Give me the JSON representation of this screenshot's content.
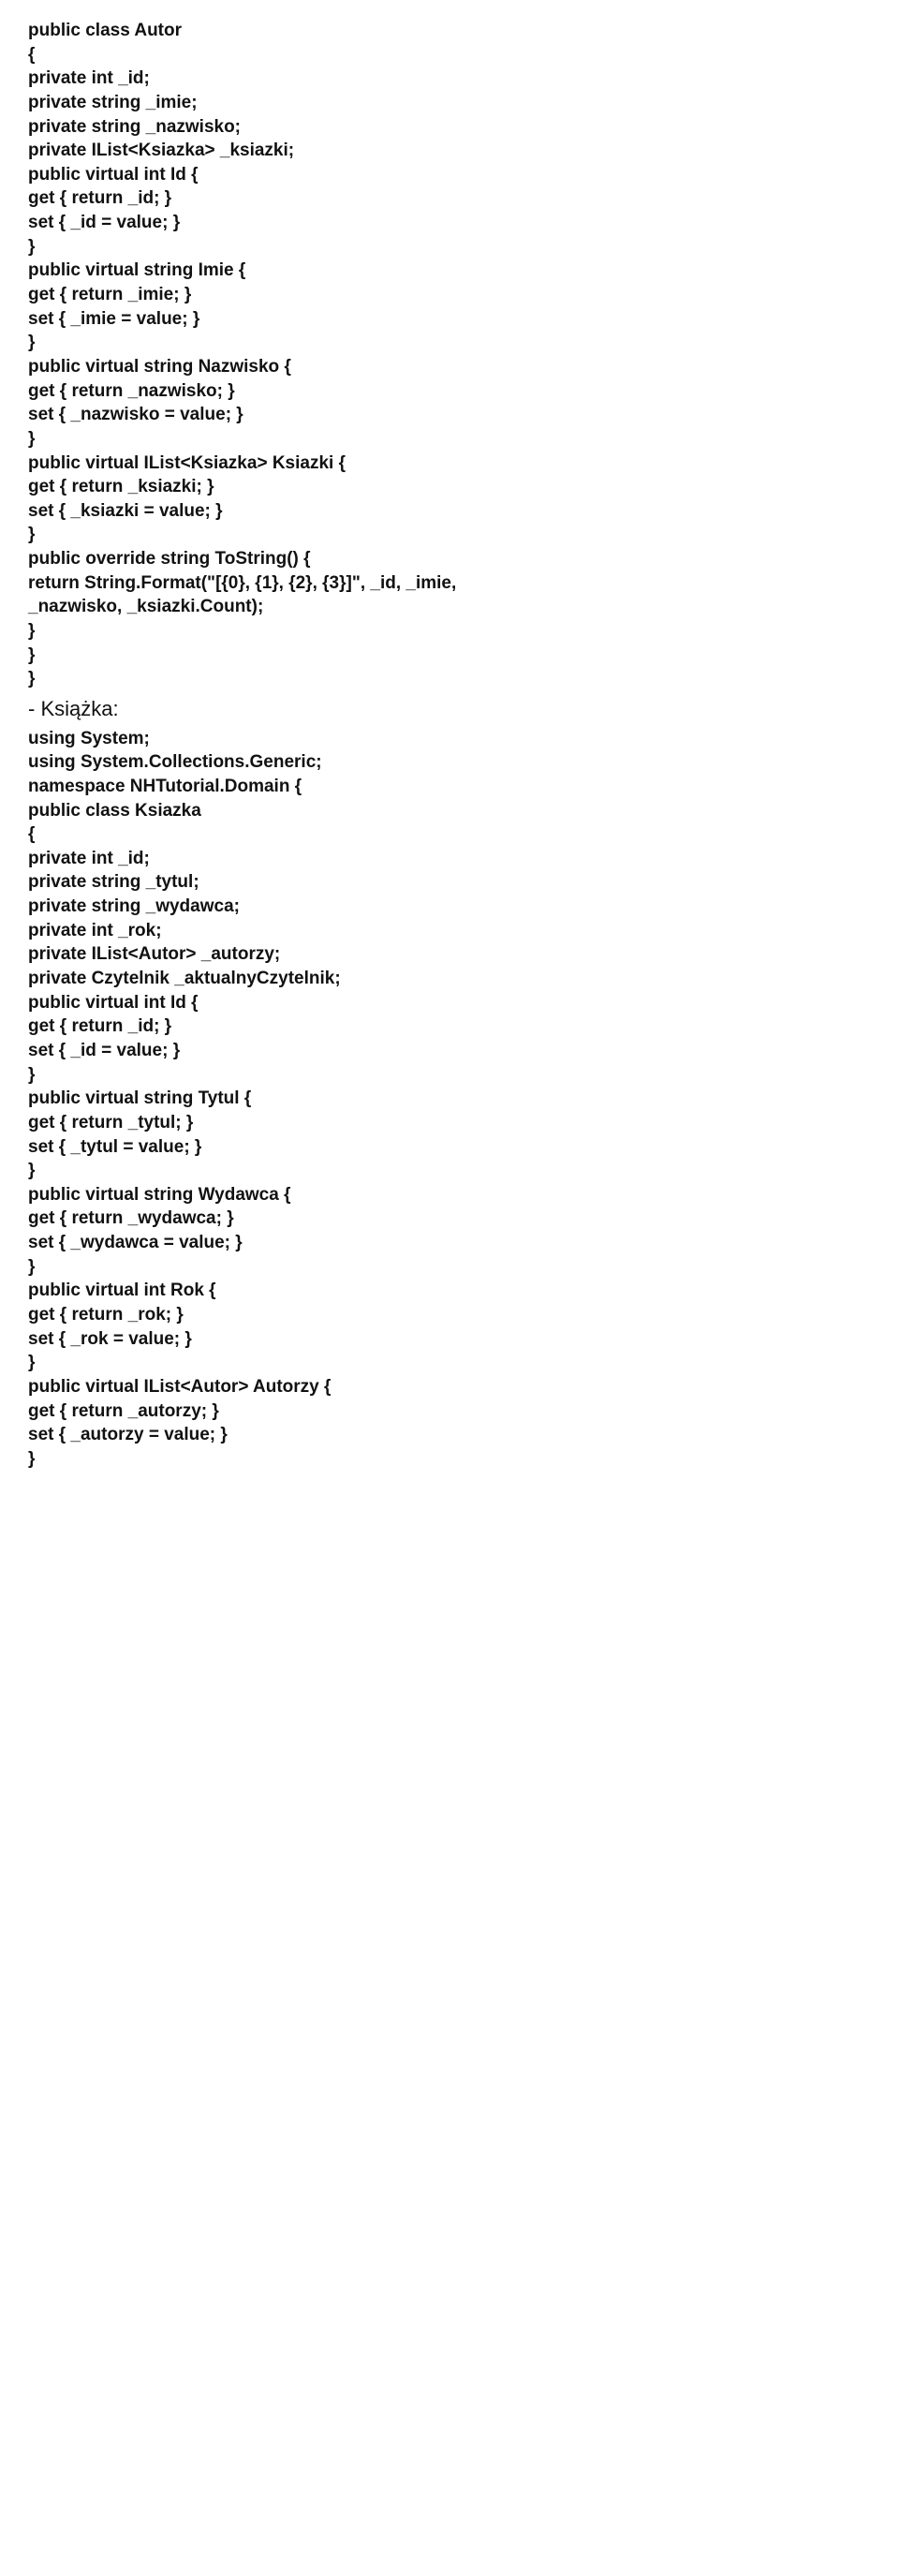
{
  "lines": [
    {
      "type": "code",
      "text": "public class Autor"
    },
    {
      "type": "code",
      "text": "{"
    },
    {
      "type": "code",
      "text": "private int _id;"
    },
    {
      "type": "code",
      "text": "private string _imie;"
    },
    {
      "type": "code",
      "text": "private string _nazwisko;"
    },
    {
      "type": "code",
      "text": "private IList<Ksiazka> _ksiazki;"
    },
    {
      "type": "code",
      "text": "public virtual int Id {"
    },
    {
      "type": "code",
      "text": "get { return _id; }"
    },
    {
      "type": "code",
      "text": "set { _id = value; }"
    },
    {
      "type": "code",
      "text": "}"
    },
    {
      "type": "code",
      "text": "public virtual string Imie {"
    },
    {
      "type": "code",
      "text": "get { return _imie; }"
    },
    {
      "type": "code",
      "text": "set { _imie = value; }"
    },
    {
      "type": "code",
      "text": "}"
    },
    {
      "type": "code",
      "text": "public virtual string Nazwisko {"
    },
    {
      "type": "code",
      "text": "get { return _nazwisko; }"
    },
    {
      "type": "code",
      "text": "set { _nazwisko = value; }"
    },
    {
      "type": "code",
      "text": "}"
    },
    {
      "type": "code",
      "text": "public virtual IList<Ksiazka> Ksiazki {"
    },
    {
      "type": "code",
      "text": "get { return _ksiazki; }"
    },
    {
      "type": "code",
      "text": "set { _ksiazki = value; }"
    },
    {
      "type": "code",
      "text": "}"
    },
    {
      "type": "code",
      "text": "public override string ToString() {"
    },
    {
      "type": "code",
      "text": "return String.Format(\"[{0}, {1}, {2}, {3}]\", _id, _imie,"
    },
    {
      "type": "code",
      "text": "_nazwisko, _ksiazki.Count);"
    },
    {
      "type": "code",
      "text": "}"
    },
    {
      "type": "code",
      "text": "}"
    },
    {
      "type": "code",
      "text": "}"
    },
    {
      "type": "heading",
      "text": "- Książka:"
    },
    {
      "type": "code",
      "text": "using System;"
    },
    {
      "type": "code",
      "text": "using System.Collections.Generic;"
    },
    {
      "type": "code",
      "text": "namespace NHTutorial.Domain {"
    },
    {
      "type": "code",
      "text": "public class Ksiazka"
    },
    {
      "type": "code",
      "text": "{"
    },
    {
      "type": "code",
      "text": "private int _id;"
    },
    {
      "type": "code",
      "text": "private string _tytul;"
    },
    {
      "type": "code",
      "text": "private string _wydawca;"
    },
    {
      "type": "code",
      "text": "private int _rok;"
    },
    {
      "type": "code",
      "text": "private IList<Autor> _autorzy;"
    },
    {
      "type": "code",
      "text": "private Czytelnik _aktualnyCzytelnik;"
    },
    {
      "type": "code",
      "text": "public virtual int Id {"
    },
    {
      "type": "code",
      "text": "get { return _id; }"
    },
    {
      "type": "code",
      "text": "set { _id = value; }"
    },
    {
      "type": "code",
      "text": "}"
    },
    {
      "type": "code",
      "text": "public virtual string Tytul {"
    },
    {
      "type": "code",
      "text": "get { return _tytul; }"
    },
    {
      "type": "code",
      "text": "set { _tytul = value; }"
    },
    {
      "type": "code",
      "text": "}"
    },
    {
      "type": "code",
      "text": "public virtual string Wydawca {"
    },
    {
      "type": "code",
      "text": "get { return _wydawca; }"
    },
    {
      "type": "code",
      "text": "set { _wydawca = value; }"
    },
    {
      "type": "code",
      "text": "}"
    },
    {
      "type": "code",
      "text": "public virtual int Rok {"
    },
    {
      "type": "code",
      "text": "get { return _rok; }"
    },
    {
      "type": "code",
      "text": "set { _rok = value; }"
    },
    {
      "type": "code",
      "text": "}"
    },
    {
      "type": "code",
      "text": "public virtual IList<Autor> Autorzy {"
    },
    {
      "type": "code",
      "text": "get { return _autorzy; }"
    },
    {
      "type": "code",
      "text": "set { _autorzy = value; }"
    },
    {
      "type": "code",
      "text": "}"
    }
  ]
}
